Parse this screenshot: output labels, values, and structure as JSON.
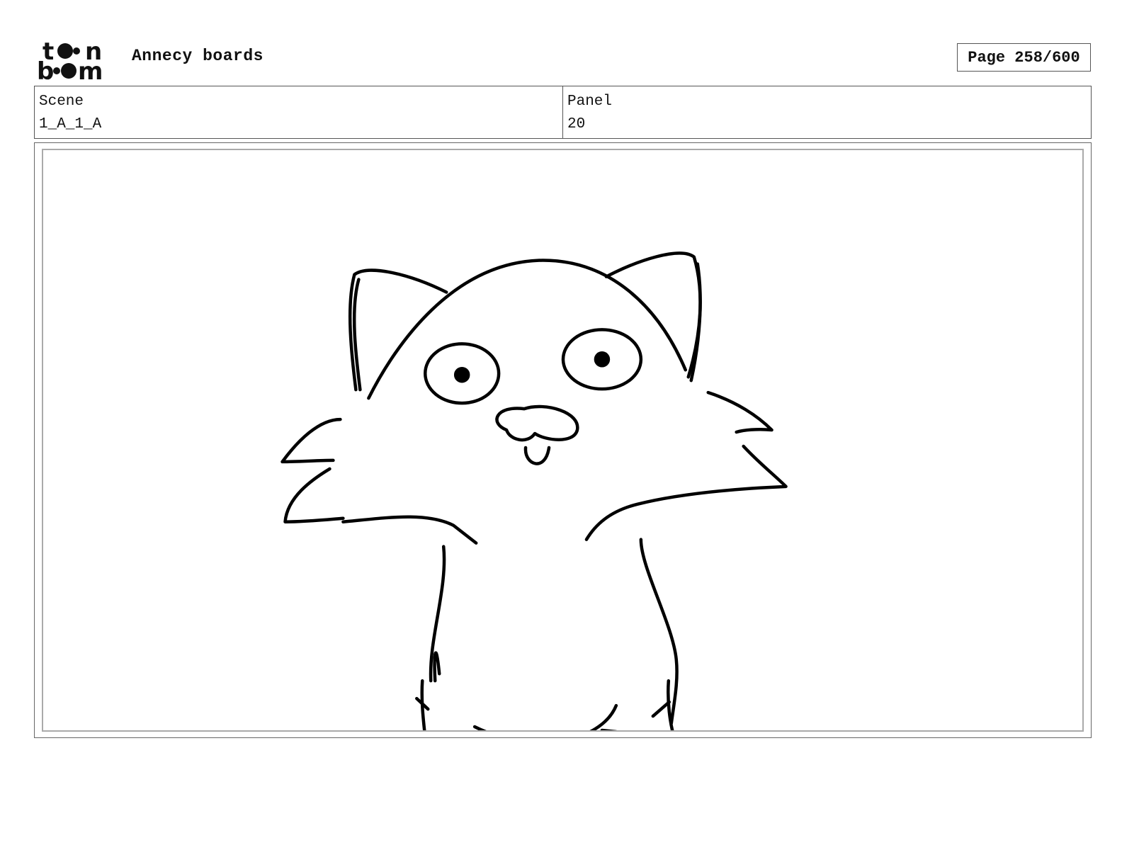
{
  "header": {
    "logo_text": [
      "t",
      "n",
      "b",
      "m"
    ],
    "project_title": "Annecy boards",
    "page_label": "Page 258/600"
  },
  "info": {
    "scene_label": "Scene",
    "scene_value": "1_A_1_A",
    "panel_label": "Panel",
    "panel_value": "20"
  },
  "panel": {
    "drawing_subject": "cat-sketch",
    "line_color": "#000000"
  }
}
